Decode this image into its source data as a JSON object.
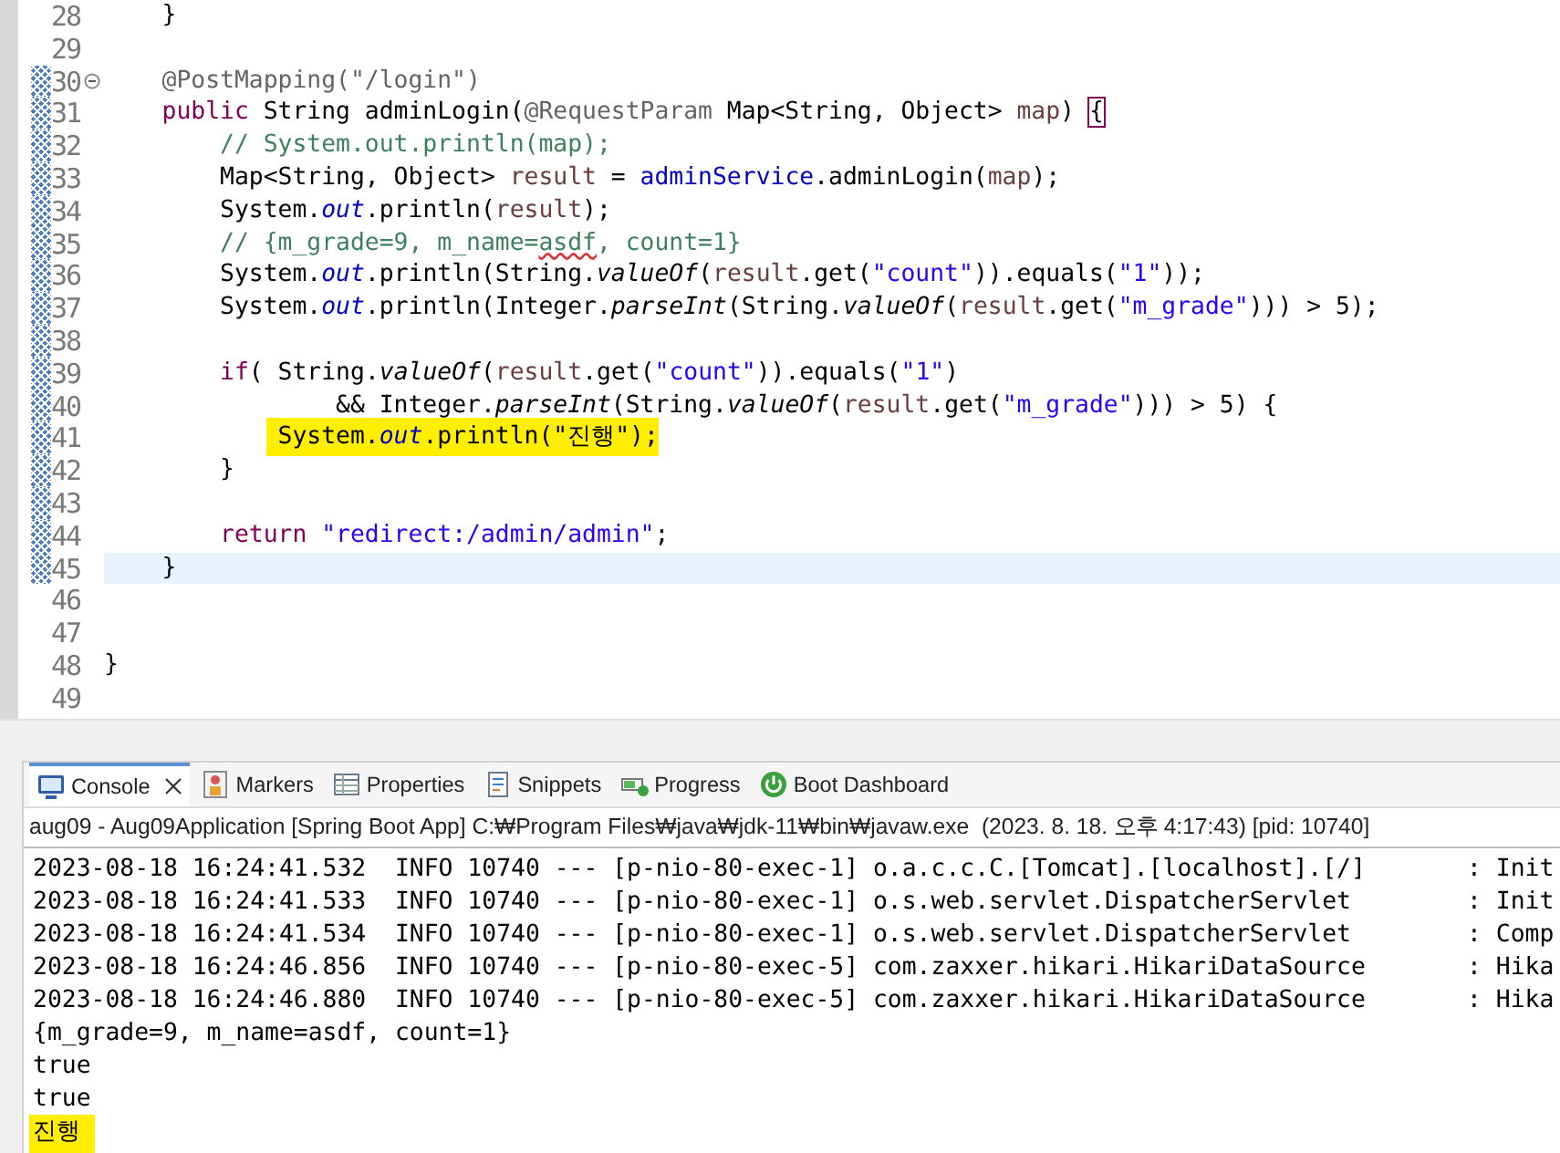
{
  "editor": {
    "lines": [
      {
        "number": "28",
        "tokens": [
          {
            "text": "    }",
            "kind": "plain"
          }
        ],
        "changed": false,
        "foldable": false,
        "current": false,
        "highlighted": false
      },
      {
        "number": "29",
        "changed": false,
        "foldable": false,
        "current": false
      },
      {
        "number": "30",
        "tokens": [
          {
            "text": "    @PostMapping(\"/login\")",
            "kind": "annotation"
          }
        ],
        "changed": true,
        "foldable": true,
        "current": false,
        "highlighted": false
      },
      {
        "number": "31",
        "tokens": [
          {
            "text": "    public",
            "kind": "keyword"
          },
          {
            "text": " String adminLogin(",
            "kind": "plain"
          },
          {
            "text": "@RequestParam",
            "kind": "annotation"
          },
          {
            "text": " Map<String, Object> ",
            "kind": "plain"
          },
          {
            "text": "map",
            "kind": "variable"
          },
          {
            "text": ") ",
            "kind": "plain"
          },
          {
            "text": "{",
            "kind": "bracket-match"
          }
        ],
        "changed": true,
        "foldable": false,
        "current": false,
        "highlighted": false
      },
      {
        "number": "32",
        "tokens": [
          {
            "text": "        // System.out.println(map);",
            "kind": "comment"
          }
        ],
        "changed": true,
        "foldable": false,
        "current": false,
        "highlighted": false
      },
      {
        "number": "33",
        "tokens": [
          {
            "text": "        Map<String, Object> ",
            "kind": "plain"
          },
          {
            "text": "result",
            "kind": "variable"
          },
          {
            "text": " = ",
            "kind": "plain"
          },
          {
            "text": "adminService",
            "kind": "field"
          },
          {
            "text": ".adminLogin(",
            "kind": "plain"
          },
          {
            "text": "map",
            "kind": "variable"
          },
          {
            "text": ");",
            "kind": "plain"
          }
        ],
        "changed": true,
        "foldable": false,
        "current": false,
        "highlighted": false
      },
      {
        "number": "34",
        "tokens": [
          {
            "text": "        System.",
            "kind": "plain"
          },
          {
            "text": "out",
            "kind": "static-field"
          },
          {
            "text": ".println(",
            "kind": "plain"
          },
          {
            "text": "result",
            "kind": "variable"
          },
          {
            "text": ");",
            "kind": "plain"
          }
        ],
        "changed": true,
        "foldable": false,
        "current": false,
        "highlighted": false
      },
      {
        "number": "35",
        "tokens": [
          {
            "text": "        // {m_grade=9, m_name=",
            "kind": "comment"
          },
          {
            "text": "asdf",
            "kind": "comment-typo"
          },
          {
            "text": ", count=1}",
            "kind": "comment"
          }
        ],
        "changed": true,
        "foldable": false,
        "current": false,
        "highlighted": false
      },
      {
        "number": "36",
        "tokens": [
          {
            "text": "        System.",
            "kind": "plain"
          },
          {
            "text": "out",
            "kind": "static-field"
          },
          {
            "text": ".println(String.",
            "kind": "plain"
          },
          {
            "text": "valueOf",
            "kind": "static-method"
          },
          {
            "text": "(",
            "kind": "plain"
          },
          {
            "text": "result",
            "kind": "variable"
          },
          {
            "text": ".get(",
            "kind": "plain"
          },
          {
            "text": "\"count\"",
            "kind": "string"
          },
          {
            "text": ")).equals(",
            "kind": "plain"
          },
          {
            "text": "\"1\"",
            "kind": "string"
          },
          {
            "text": "));",
            "kind": "plain"
          }
        ],
        "changed": true,
        "foldable": false,
        "current": false,
        "highlighted": false
      },
      {
        "number": "37",
        "tokens": [
          {
            "text": "        System.",
            "kind": "plain"
          },
          {
            "text": "out",
            "kind": "static-field"
          },
          {
            "text": ".println(Integer.",
            "kind": "plain"
          },
          {
            "text": "parseInt",
            "kind": "static-method"
          },
          {
            "text": "(String.",
            "kind": "plain"
          },
          {
            "text": "valueOf",
            "kind": "static-method"
          },
          {
            "text": "(",
            "kind": "plain"
          },
          {
            "text": "result",
            "kind": "variable"
          },
          {
            "text": ".get(",
            "kind": "plain"
          },
          {
            "text": "\"m_grade\"",
            "kind": "string"
          },
          {
            "text": "))) > 5);",
            "kind": "plain"
          }
        ],
        "changed": true,
        "foldable": false,
        "current": false,
        "highlighted": false
      },
      {
        "number": "38",
        "changed": true,
        "foldable": false,
        "current": false
      },
      {
        "number": "39",
        "tokens": [
          {
            "text": "        if",
            "kind": "keyword"
          },
          {
            "text": "( String.",
            "kind": "plain"
          },
          {
            "text": "valueOf",
            "kind": "static-method"
          },
          {
            "text": "(",
            "kind": "plain"
          },
          {
            "text": "result",
            "kind": "variable"
          },
          {
            "text": ".get(",
            "kind": "plain"
          },
          {
            "text": "\"count\"",
            "kind": "string"
          },
          {
            "text": ")).equals(",
            "kind": "plain"
          },
          {
            "text": "\"1\"",
            "kind": "string"
          },
          {
            "text": ")",
            "kind": "plain"
          }
        ],
        "changed": true,
        "foldable": false,
        "current": false,
        "highlighted": false
      },
      {
        "number": "40",
        "tokens": [
          {
            "text": "                && Integer.",
            "kind": "plain"
          },
          {
            "text": "parseInt",
            "kind": "static-method"
          },
          {
            "text": "(String.",
            "kind": "plain"
          },
          {
            "text": "valueOf",
            "kind": "static-method"
          },
          {
            "text": "(",
            "kind": "plain"
          },
          {
            "text": "result",
            "kind": "variable"
          },
          {
            "text": ".get(",
            "kind": "plain"
          },
          {
            "text": "\"m_grade\"",
            "kind": "string"
          },
          {
            "text": "))) > 5) {",
            "kind": "plain"
          }
        ],
        "changed": true,
        "foldable": false,
        "current": false,
        "highlighted": false
      },
      {
        "number": "41",
        "tokens": [
          {
            "text": "            System.",
            "kind": "plain"
          },
          {
            "text": "out",
            "kind": "static-field"
          },
          {
            "text": ".println(\"진행\");",
            "kind": "plain"
          }
        ],
        "changed": true,
        "foldable": false,
        "current": false,
        "highlighted": true
      },
      {
        "number": "42",
        "tokens": [
          {
            "text": "        }",
            "kind": "plain"
          }
        ],
        "changed": true,
        "foldable": false,
        "current": false,
        "highlighted": false
      },
      {
        "number": "43",
        "changed": true,
        "foldable": false,
        "current": false
      },
      {
        "number": "44",
        "tokens": [
          {
            "text": "        return ",
            "kind": "keyword"
          },
          {
            "text": "\"redirect:/admin/admin\"",
            "kind": "string"
          },
          {
            "text": ";",
            "kind": "plain"
          }
        ],
        "changed": true,
        "foldable": false,
        "current": false,
        "highlighted": false
      },
      {
        "number": "45",
        "tokens": [
          {
            "text": "    }",
            "kind": "plain"
          }
        ],
        "changed": true,
        "foldable": false,
        "current": true,
        "highlighted": false
      },
      {
        "number": "46",
        "changed": false,
        "foldable": false,
        "current": false
      },
      {
        "number": "47",
        "changed": false,
        "foldable": false,
        "current": false
      },
      {
        "number": "48",
        "tokens": [
          {
            "text": "}",
            "kind": "plain"
          }
        ],
        "changed": false,
        "foldable": false,
        "current": false,
        "highlighted": false
      },
      {
        "number": "49",
        "changed": false,
        "foldable": false,
        "current": false
      }
    ]
  },
  "console": {
    "tabs": [
      {
        "label": "Console",
        "kind": "console",
        "selected": true,
        "closable": true
      },
      {
        "label": "Markers",
        "kind": "markers",
        "selected": false,
        "closable": false
      },
      {
        "label": "Properties",
        "kind": "properties",
        "selected": false,
        "closable": false
      },
      {
        "label": "Snippets",
        "kind": "snippets",
        "selected": false,
        "closable": false
      },
      {
        "label": "Progress",
        "kind": "progress",
        "selected": false,
        "closable": false
      },
      {
        "label": "Boot Dashboard",
        "kind": "boot",
        "selected": false,
        "closable": false
      }
    ],
    "title": "aug09 - Aug09Application [Spring Boot App] C:₩Program Files₩java₩jdk-11₩bin₩javaw.exe  (2023. 8. 18. 오후 4:17:43) [pid: 10740]",
    "output": [
      {
        "text": "2023-08-18 16:24:41.532  INFO 10740 --- [p-nio-80-exec-1] o.a.c.c.C.[Tomcat].[localhost].[/]       : Init",
        "highlighted": false
      },
      {
        "text": "2023-08-18 16:24:41.533  INFO 10740 --- [p-nio-80-exec-1] o.s.web.servlet.DispatcherServlet        : Init",
        "highlighted": false
      },
      {
        "text": "2023-08-18 16:24:41.534  INFO 10740 --- [p-nio-80-exec-1] o.s.web.servlet.DispatcherServlet        : Comp",
        "highlighted": false
      },
      {
        "text": "2023-08-18 16:24:46.856  INFO 10740 --- [p-nio-80-exec-5] com.zaxxer.hikari.HikariDataSource       : Hika",
        "highlighted": false
      },
      {
        "text": "2023-08-18 16:24:46.880  INFO 10740 --- [p-nio-80-exec-5] com.zaxxer.hikari.HikariDataSource       : Hika",
        "highlighted": false
      },
      {
        "text": "{m_grade=9, m_name=asdf, count=1}",
        "highlighted": false
      },
      {
        "text": "true",
        "highlighted": false
      },
      {
        "text": "true",
        "highlighted": false
      },
      {
        "text": "진행",
        "highlighted": true
      }
    ]
  }
}
